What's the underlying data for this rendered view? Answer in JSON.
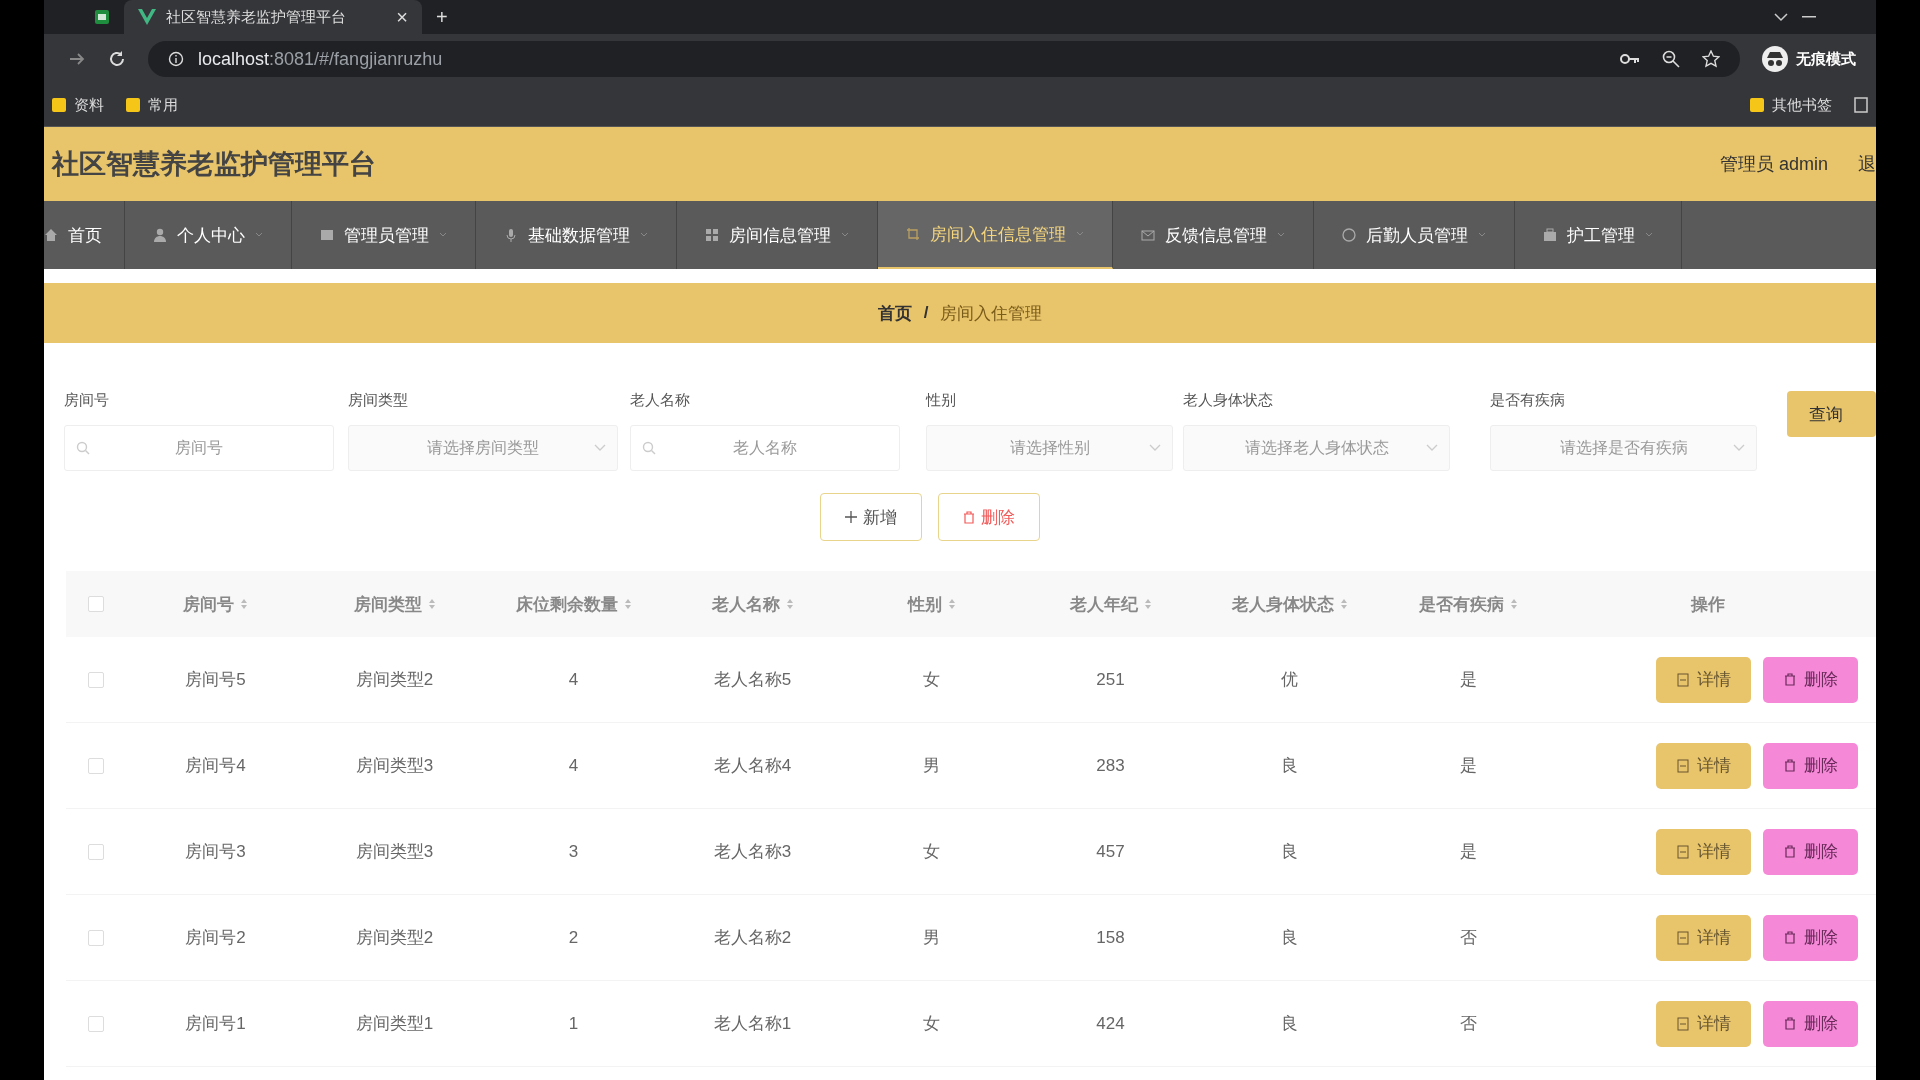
{
  "browser": {
    "tab_title": "社区智慧养老监护管理平台",
    "tab_close": "×",
    "new_tab": "+",
    "url_host": "localhost",
    "url_rest": ":8081/#/fangjianruzhu",
    "incognito": "无痕模式",
    "bookmarks": [
      "资料",
      "常用"
    ],
    "other_bookmarks": "其他书签"
  },
  "header": {
    "title": "社区智慧养老监护管理平台",
    "user": "管理员 admin",
    "logout": "退"
  },
  "nav": [
    {
      "label": "首页",
      "selected": false
    },
    {
      "label": "个人中心",
      "selected": false
    },
    {
      "label": "管理员管理",
      "selected": false
    },
    {
      "label": "基础数据管理",
      "selected": false
    },
    {
      "label": "房间信息管理",
      "selected": false
    },
    {
      "label": "房间入住信息管理",
      "selected": true
    },
    {
      "label": "反馈信息管理",
      "selected": false
    },
    {
      "label": "后勤人员管理",
      "selected": false
    },
    {
      "label": "护工管理",
      "selected": false
    }
  ],
  "breadcrumb": {
    "home": "首页",
    "separator": "/",
    "current": "房间入住管理"
  },
  "filters": [
    {
      "label": "房间号",
      "placeholder": "房间号",
      "kind": "search"
    },
    {
      "label": "房间类型",
      "placeholder": "请选择房间类型",
      "kind": "select"
    },
    {
      "label": "老人名称",
      "placeholder": "老人名称",
      "kind": "search"
    },
    {
      "label": "性别",
      "placeholder": "请选择性别",
      "kind": "select"
    },
    {
      "label": "老人身体状态",
      "placeholder": "请选择老人身体状态",
      "kind": "select"
    },
    {
      "label": "是否有疾病",
      "placeholder": "请选择是否有疾病",
      "kind": "select"
    }
  ],
  "query_button": "查询",
  "actions": [
    {
      "label": "新增",
      "kind": "add"
    },
    {
      "label": "删除",
      "kind": "delete"
    }
  ],
  "table": {
    "all_checked": false,
    "columns": [
      {
        "label": "房间号"
      },
      {
        "label": "房间类型"
      },
      {
        "label": "床位剩余数量"
      },
      {
        "label": "老人名称"
      },
      {
        "label": "性别"
      },
      {
        "label": "老人年纪"
      },
      {
        "label": "老人身体状态"
      },
      {
        "label": "是否有疾病"
      }
    ],
    "action_column": "操作",
    "rows": [
      {
        "checked": false,
        "cells": [
          "房间号5",
          "房间类型2",
          "4",
          "老人名称5",
          "女",
          "251",
          "优",
          "是"
        ],
        "detail": "详情",
        "delete": "删除"
      },
      {
        "checked": false,
        "cells": [
          "房间号4",
          "房间类型3",
          "4",
          "老人名称4",
          "男",
          "283",
          "良",
          "是"
        ],
        "detail": "详情",
        "delete": "删除"
      },
      {
        "checked": false,
        "cells": [
          "房间号3",
          "房间类型3",
          "3",
          "老人名称3",
          "女",
          "457",
          "良",
          "是"
        ],
        "detail": "详情",
        "delete": "删除"
      },
      {
        "checked": false,
        "cells": [
          "房间号2",
          "房间类型2",
          "2",
          "老人名称2",
          "男",
          "158",
          "良",
          "否"
        ],
        "detail": "详情",
        "delete": "删除"
      },
      {
        "checked": false,
        "cells": [
          "房间号1",
          "房间类型1",
          "1",
          "老人名称1",
          "女",
          "424",
          "良",
          "否"
        ],
        "detail": "详情",
        "delete": "删除"
      }
    ]
  }
}
